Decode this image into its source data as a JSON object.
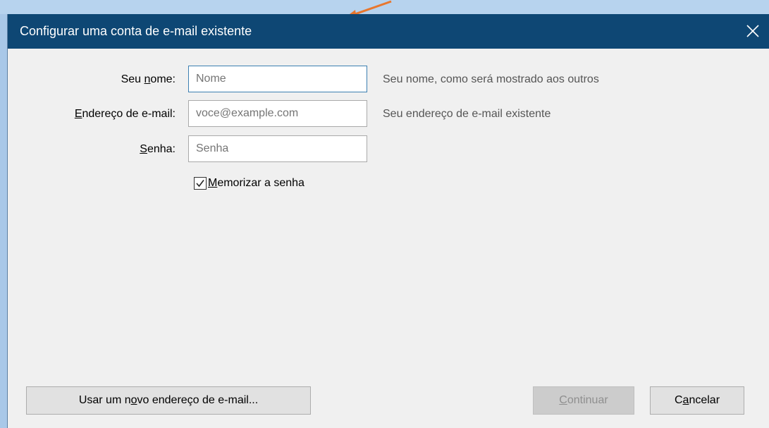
{
  "dialog": {
    "title": "Configurar uma conta de e-mail existente"
  },
  "form": {
    "name_label": {
      "before": "Seu ",
      "accel": "n",
      "after": "ome:"
    },
    "name_placeholder": "Nome",
    "name_hint": "Seu nome, como será mostrado aos outros",
    "email_label": {
      "before": "",
      "accel": "E",
      "after": "ndereço de e-mail:"
    },
    "email_placeholder": "voce@example.com",
    "email_hint": "Seu endereço de e-mail existente",
    "password_label": {
      "before": "",
      "accel": "S",
      "after": "enha:"
    },
    "password_placeholder": "Senha",
    "remember_label": {
      "before": "",
      "accel": "M",
      "after": "emorizar a senha"
    },
    "remember_checked": true
  },
  "buttons": {
    "new_address": {
      "before": "Usar um n",
      "accel": "o",
      "after": "vo endereço de e-mail..."
    },
    "continue": {
      "before": "",
      "accel": "C",
      "after": "ontinuar"
    },
    "cancel": {
      "before": "C",
      "accel": "a",
      "after": "ncelar"
    }
  },
  "colors": {
    "titlebar": "#0e4774",
    "background": "#f0f0f0",
    "annotation_arrow": "#e8772e"
  }
}
